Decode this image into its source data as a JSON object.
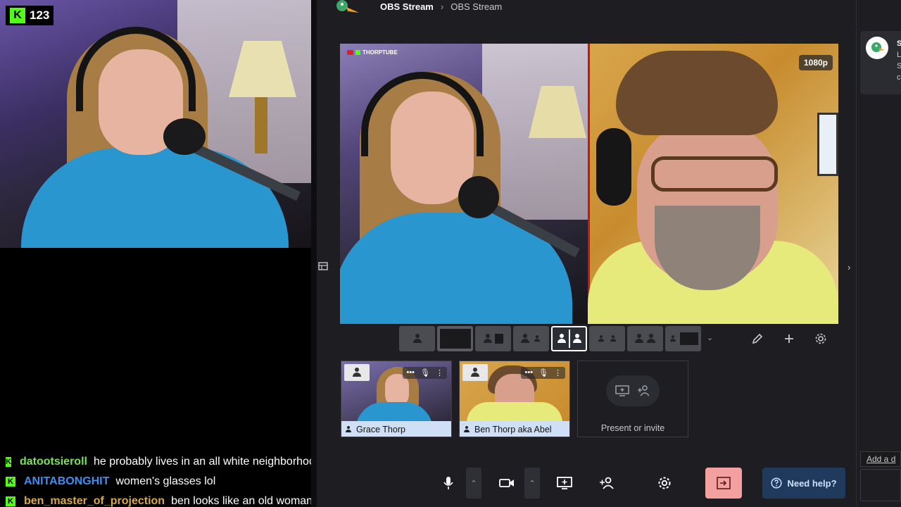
{
  "overlay": {
    "viewer_count": "123"
  },
  "chat": [
    {
      "user": "datootsieroll",
      "message": "he probably lives in an all white neighborhood",
      "color": "#7be05b"
    },
    {
      "user": "ANITABONGHIT",
      "message": "women's glasses lol",
      "color": "#3f8ef0"
    },
    {
      "user": "ben_master_of_projection",
      "message": "ben looks like an old woman",
      "color": "#d8a848"
    }
  ],
  "breadcrumb": {
    "studio": "OBS Stream",
    "broadcast": "OBS Stream"
  },
  "stage": {
    "watermark": "THORPTUBE",
    "resolution_badge": "1080p"
  },
  "layout_options": [
    "solo",
    "solo-screen",
    "screen-pip",
    "group",
    "side-by-side",
    "group-small",
    "group-screen",
    "screen-sidebar"
  ],
  "selected_layout": "side-by-side",
  "participants": [
    {
      "name": "Grace Thorp"
    },
    {
      "name": "Ben Thorp aka Abel"
    }
  ],
  "invite": {
    "label": "Present or invite"
  },
  "controls": {
    "help_label": "Need help?"
  },
  "comments": {
    "add_label": "Add a d",
    "preview_lines": [
      "S",
      "L",
      "S",
      "c"
    ]
  },
  "colors": {
    "kick_green": "#53fc18",
    "app_bg": "#1e1e22",
    "leave_button": "#f4a0a0",
    "help_button": "#1f3a5c"
  }
}
